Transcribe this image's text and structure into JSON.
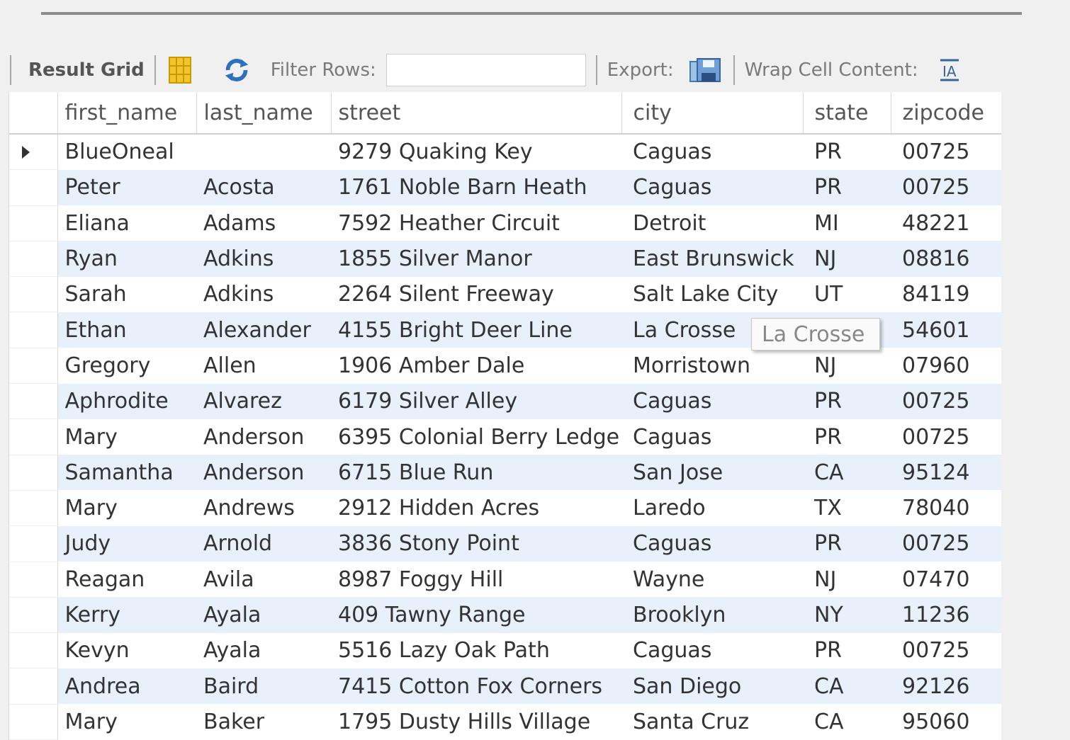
{
  "toolbar": {
    "title": "Result Grid",
    "filter_label": "Filter Rows:",
    "filter_value": "",
    "export_label": "Export:",
    "wrap_label": "Wrap Cell Content:"
  },
  "grid": {
    "columns": [
      "first_name",
      "last_name",
      "street",
      "city",
      "state",
      "zipcode"
    ],
    "rows": [
      [
        "BlueOneal",
        "",
        "9279 Quaking Key",
        "Caguas",
        "PR",
        "00725"
      ],
      [
        "Peter",
        "Acosta",
        "1761 Noble Barn Heath",
        "Caguas",
        "PR",
        "00725"
      ],
      [
        "Eliana",
        "Adams",
        "7592 Heather Circuit",
        "Detroit",
        "MI",
        "48221"
      ],
      [
        "Ryan",
        "Adkins",
        "1855 Silver Manor",
        "East Brunswick",
        "NJ",
        "08816"
      ],
      [
        "Sarah",
        "Adkins",
        "2264 Silent Freeway",
        "Salt Lake City",
        "UT",
        "84119"
      ],
      [
        "Ethan",
        "Alexander",
        "4155 Bright Deer Line",
        "La Crosse",
        "",
        "54601"
      ],
      [
        "Gregory",
        "Allen",
        "1906 Amber Dale",
        "Morristown",
        "NJ",
        "07960"
      ],
      [
        "Aphrodite",
        "Alvarez",
        "6179 Silver Alley",
        "Caguas",
        "PR",
        "00725"
      ],
      [
        "Mary",
        "Anderson",
        "6395 Colonial Berry Ledge",
        "Caguas",
        "PR",
        "00725"
      ],
      [
        "Samantha",
        "Anderson",
        "6715 Blue Run",
        "San Jose",
        "CA",
        "95124"
      ],
      [
        "Mary",
        "Andrews",
        "2912 Hidden Acres",
        "Laredo",
        "TX",
        "78040"
      ],
      [
        "Judy",
        "Arnold",
        "3836 Stony Point",
        "Caguas",
        "PR",
        "00725"
      ],
      [
        "Reagan",
        "Avila",
        "8987 Foggy Hill",
        "Wayne",
        "NJ",
        "07470"
      ],
      [
        "Kerry",
        "Ayala",
        "409 Tawny Range",
        "Brooklyn",
        "NY",
        "11236"
      ],
      [
        "Kevyn",
        "Ayala",
        "5516 Lazy Oak Path",
        "Caguas",
        "PR",
        "00725"
      ],
      [
        "Andrea",
        "Baird",
        "7415 Cotton Fox Corners",
        "San Diego",
        "CA",
        "92126"
      ],
      [
        "Mary",
        "Baker",
        "1795 Dusty Hills Village",
        "Santa Cruz",
        "CA",
        "95060"
      ]
    ],
    "selected_row": 0
  },
  "tooltip": {
    "text": "La Crosse"
  },
  "colors": {
    "row_alt": "#e8f0fb",
    "accent_blue": "#2f6fc2",
    "grid_icon": "#e5b300"
  },
  "icons": {
    "grid": "grid-layout-icon",
    "refresh": "refresh-icon",
    "export": "save-export-icon",
    "wrap": "wrap-text-icon"
  }
}
